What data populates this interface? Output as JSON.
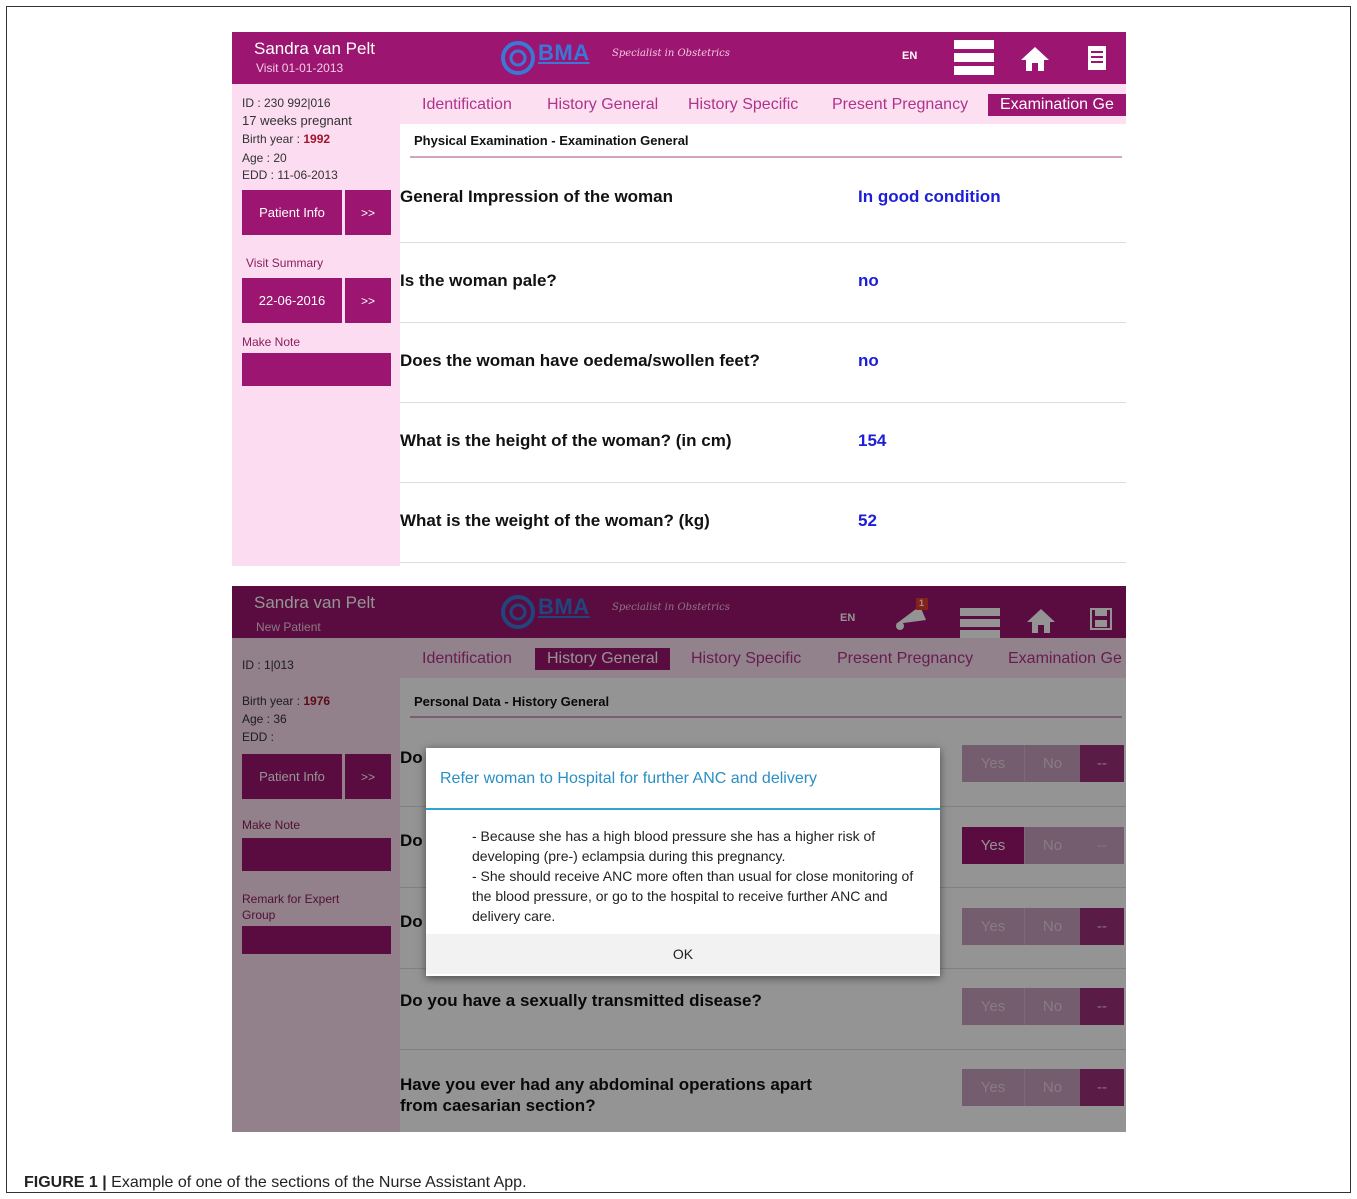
{
  "caption": {
    "label": "FIGURE 1 |",
    "text": "Example of one of the sections of the Nurse Assistant App."
  },
  "app": {
    "logo_text": "BMA",
    "tagline": "Specialist in Obstetrics",
    "lang": "EN",
    "accent": "#9c1570",
    "answer_color": "#1c1ed8"
  },
  "screen1": {
    "header": {
      "patient_name": "Sandra van Pelt",
      "visit": "Visit 01-01-2013"
    },
    "sidebar": {
      "id": "ID : 230 992|016",
      "weeks": "17 weeks pregnant",
      "birth_year_label": "Birth year : ",
      "birth_year": "1992",
      "age": "Age : 20",
      "edd": "EDD : 11-06-2013",
      "patient_info": "Patient Info",
      "arrow": ">>",
      "visit_summary": "Visit Summary",
      "summary_date": "22-06-2016",
      "make_note": "Make Note"
    },
    "tabs": [
      "Identification",
      "History General",
      "History Specific",
      "Present Pregnancy",
      "Examination Ge"
    ],
    "active_tab": "Examination Ge",
    "section_title": "Physical Examination - Examination General",
    "questions": [
      {
        "q": "General Impression of the woman",
        "a": "In good condition"
      },
      {
        "q": "Is the woman pale?",
        "a": "no"
      },
      {
        "q": "Does the woman have oedema/swollen feet?",
        "a": "no"
      },
      {
        "q": "What is the height of the woman? (in cm)",
        "a": "154"
      },
      {
        "q": "What is the weight of the woman? (kg)",
        "a": "52"
      }
    ]
  },
  "screen2": {
    "header": {
      "patient_name": "Sandra van Pelt",
      "visit": "New Patient",
      "notification_count": "1"
    },
    "sidebar": {
      "id": "ID : 1|013",
      "birth_year_label": "Birth year : ",
      "birth_year": "1976",
      "age": "Age : 36",
      "edd": "EDD :",
      "patient_info": "Patient Info",
      "arrow": ">>",
      "make_note": "Make Note",
      "remark": "Remark for Expert Group"
    },
    "tabs": [
      "Identification",
      "History General",
      "History Specific",
      "Present Pregnancy",
      "Examination Ge"
    ],
    "active_tab": "History General",
    "section_title": "Personal Data - History General",
    "yn": {
      "yes": "Yes",
      "no": "No",
      "dash": "--"
    },
    "questions": [
      {
        "q": "Do",
        "selected": "dash"
      },
      {
        "q": "Do",
        "selected": "yes"
      },
      {
        "q": "Do",
        "selected": "dash"
      },
      {
        "q": "Do you have a sexually transmitted disease?",
        "selected": "dash"
      },
      {
        "q": "Have you ever had any abdominal operations apart from caesarian section?",
        "selected": "dash"
      }
    ],
    "dialog": {
      "title": "Refer woman to Hospital for further ANC and delivery",
      "body": "- Because she has a high blood pressure she has a higher risk of developing (pre-) eclampsia during this pregnancy.\n- She should receive ANC more often than usual for close monitoring of the blood pressure, or go to the hospital to receive further ANC and delivery care.",
      "ok": "OK"
    }
  }
}
